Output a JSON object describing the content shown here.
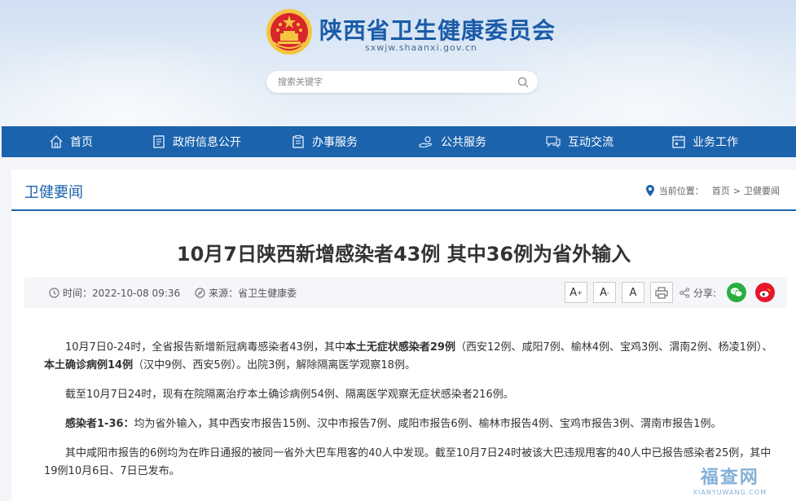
{
  "header": {
    "site_title": "陕西省卫生健康委员会",
    "site_domain": "sxwjw.shaanxi.gov.cn",
    "search_placeholder": "搜索关键字"
  },
  "nav": {
    "items": [
      {
        "label": "首页",
        "icon": "home-icon"
      },
      {
        "label": "政府信息公开",
        "icon": "document-icon"
      },
      {
        "label": "办事服务",
        "icon": "clipboard-icon"
      },
      {
        "label": "公共服务",
        "icon": "hand-service-icon"
      },
      {
        "label": "互动交流",
        "icon": "chat-icon"
      },
      {
        "label": "业务工作",
        "icon": "calendar-icon"
      }
    ]
  },
  "section": {
    "title": "卫健要闻",
    "breadcrumb_prefix": "当前位置：",
    "breadcrumb_home": "首页",
    "breadcrumb_sep": ">",
    "breadcrumb_current": "卫健要闻"
  },
  "article": {
    "title": "10月7日陕西新增感染者43例 其中36例为省外输入",
    "time_label": "时间：2022-10-08 09:36",
    "source_label": "来源：省卫生健康委",
    "font_large": "A",
    "font_large_sup": "+",
    "font_small": "A",
    "font_small_sup": "-",
    "font_reset": "A",
    "share_label": "分享:",
    "p1": {
      "t1": "10月7日0-24时，全省报告新增新冠病毒感染者43例，其中",
      "b1": "本土无症状感染者29例",
      "t2": "（西安12例、咸阳7例、榆林4例、宝鸡3例、渭南2例、杨凌1例）、",
      "b2": "本土确诊病例14例",
      "t3": "（汉中9例、西安5例）。出院3例，解除隔离医学观察18例。"
    },
    "p2": "截至10月7日24时，现有在院隔离治疗本土确诊病例54例、隔离医学观察无症状感染者216例。",
    "p3": {
      "b1": "感染者1-36：",
      "t1": "均为省外输入，其中西安市报告15例、汉中市报告7例、咸阳市报告6例、榆林市报告4例、宝鸡市报告3例、渭南市报告1例。"
    },
    "p4": "其中咸阳市报告的6例均为在昨日通报的被同一省外大巴车甩客的40人中发现。截至10月7日24时被该大巴违规甩客的40人中已报告感染者25例，其中19例10月6日、7日已发布。"
  },
  "watermark": {
    "main": "福查网",
    "sub": "XIANYUWANG.COM"
  },
  "colors": {
    "brand_blue": "#1b63ad",
    "wechat_green": "#2aae3f",
    "weibo_red": "#e6162d"
  }
}
